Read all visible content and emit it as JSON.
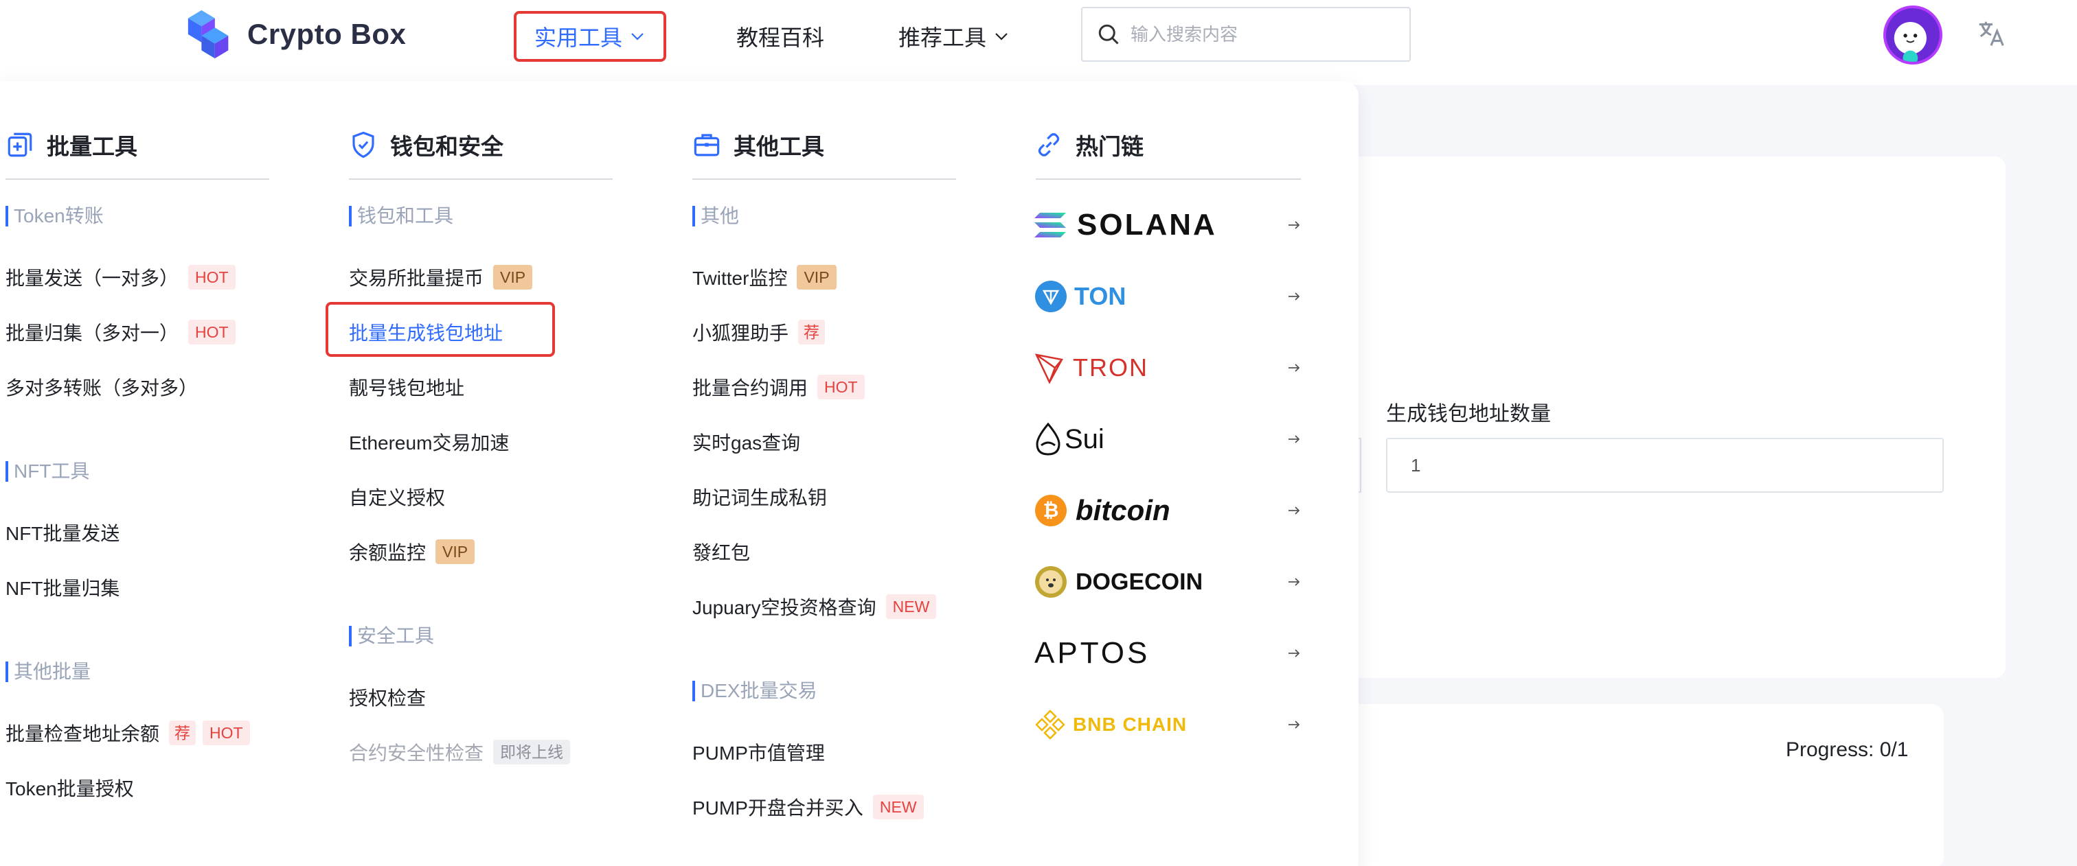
{
  "header": {
    "brand": "Crypto Box",
    "nav": [
      {
        "label": "实用工具",
        "dropdown": true,
        "active": true
      },
      {
        "label": "教程百科",
        "dropdown": false
      },
      {
        "label": "推荐工具",
        "dropdown": true
      }
    ],
    "search_placeholder": "输入搜索内容"
  },
  "menu": {
    "col1": {
      "title": "批量工具",
      "sections": [
        {
          "label": "Token转账",
          "items": [
            {
              "label": "批量发送（一对多）",
              "tags": [
                "HOT"
              ]
            },
            {
              "label": "批量归集（多对一）",
              "tags": [
                "HOT"
              ]
            },
            {
              "label": "多对多转账（多对多）",
              "tags": []
            }
          ]
        },
        {
          "label": "NFT工具",
          "items": [
            {
              "label": "NFT批量发送",
              "tags": []
            },
            {
              "label": "NFT批量归集",
              "tags": []
            }
          ]
        },
        {
          "label": "其他批量",
          "items": [
            {
              "label": "批量检查地址余额",
              "tags": [
                "荐",
                "HOT"
              ]
            },
            {
              "label": "Token批量授权",
              "tags": []
            }
          ]
        }
      ]
    },
    "col2": {
      "title": "钱包和安全",
      "sections": [
        {
          "label": "钱包和工具",
          "items": [
            {
              "label": "交易所批量提币",
              "tags": [
                "VIP"
              ]
            },
            {
              "label": "批量生成钱包地址",
              "tags": [],
              "highlighted": true
            },
            {
              "label": "靓号钱包地址",
              "tags": []
            },
            {
              "label": "Ethereum交易加速",
              "tags": []
            },
            {
              "label": "自定义授权",
              "tags": []
            },
            {
              "label": "余额监控",
              "tags": [
                "VIP"
              ]
            }
          ]
        },
        {
          "label": "安全工具",
          "items": [
            {
              "label": "授权检查",
              "tags": []
            },
            {
              "label": "合约安全性检查",
              "tags": [
                "即将上线"
              ],
              "disabled": true
            }
          ]
        }
      ]
    },
    "col3": {
      "title": "其他工具",
      "sections": [
        {
          "label": "其他",
          "items": [
            {
              "label": "Twitter监控",
              "tags": [
                "VIP"
              ]
            },
            {
              "label": "小狐狸助手",
              "tags": [
                "荐"
              ]
            },
            {
              "label": "批量合约调用",
              "tags": [
                "HOT"
              ]
            },
            {
              "label": "实时gas查询",
              "tags": []
            },
            {
              "label": "助记词生成私钥",
              "tags": []
            },
            {
              "label": "發红包",
              "tags": []
            },
            {
              "label": "Jupuary空投资格查询",
              "tags": [
                "NEW"
              ]
            }
          ]
        },
        {
          "label": "DEX批量交易",
          "items": [
            {
              "label": "PUMP市值管理",
              "tags": []
            },
            {
              "label": "PUMP开盘合并买入",
              "tags": [
                "NEW"
              ]
            }
          ]
        }
      ]
    },
    "col4": {
      "title": "热门链",
      "chains": [
        {
          "name": "SOLANA",
          "icon": "solana-logo",
          "color": "#111111"
        },
        {
          "name": "TON",
          "icon": "ton-logo",
          "color": "#2f8fe0"
        },
        {
          "name": "TRON",
          "icon": "tron-logo",
          "color": "#d6312b"
        },
        {
          "name": "Sui",
          "icon": "sui-logo",
          "color": "#111111"
        },
        {
          "name": "bitcoin",
          "icon": "bitcoin-logo",
          "color": "#111111"
        },
        {
          "name": "DOGECOIN",
          "icon": "dogecoin-logo",
          "color": "#111111"
        },
        {
          "name": "APTOS",
          "icon": "aptos-logo",
          "color": "#111111"
        },
        {
          "name": "BNB CHAIN",
          "icon": "bnb-logo",
          "color": "#f0b90b"
        }
      ]
    }
  },
  "main": {
    "field_label": "生成钱包地址数量",
    "field_value": "1",
    "progress": "Progress: 0/1"
  },
  "colors": {
    "accent": "#2f6bff",
    "highlight_border": "#e53935",
    "hot_text": "#e4433f",
    "vip_bg": "#f0c89c"
  }
}
